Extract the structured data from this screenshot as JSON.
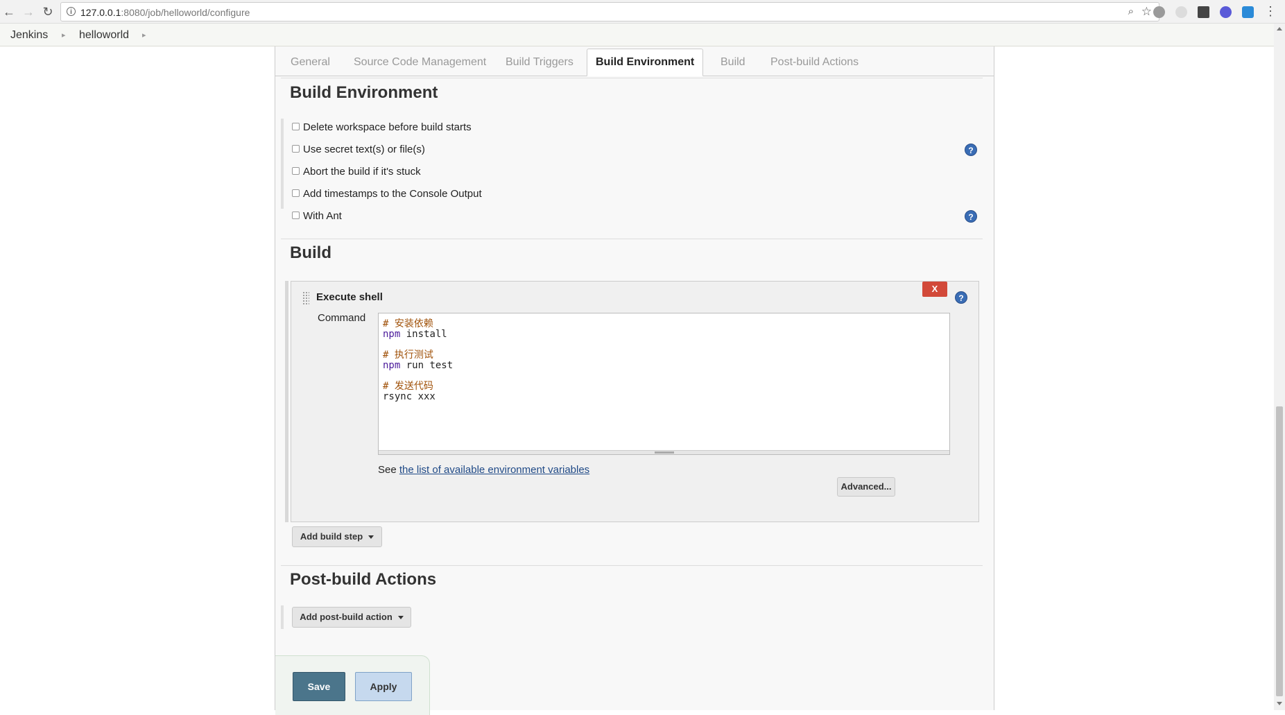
{
  "browser": {
    "url_host": "127.0.0.1",
    "url_rest": ":8080/job/helloworld/configure",
    "back_icon": "←",
    "forward_icon": "→",
    "reload_icon": "↻",
    "info_icon": "i",
    "zoom_icon": "⌕",
    "star_icon": "☆",
    "menu_icon": "⋮"
  },
  "breadcrumb": {
    "items": [
      "Jenkins",
      "helloworld"
    ],
    "arrow": "▸"
  },
  "tabs": [
    "General",
    "Source Code Management",
    "Build Triggers",
    "Build Environment",
    "Build",
    "Post-build Actions"
  ],
  "active_tab": "Build Environment",
  "build_environment": {
    "title": "Build Environment",
    "options": [
      "Delete workspace before build starts",
      "Use secret text(s) or file(s)",
      "Abort the build if it's stuck",
      "Add timestamps to the Console Output",
      "With Ant"
    ]
  },
  "build": {
    "title": "Build",
    "step_title": "Execute shell",
    "delete_label": "X",
    "command_label": "Command",
    "command_lines": [
      {
        "comment": "# 安装依赖"
      },
      {
        "kw": "npm",
        "rest": " install"
      },
      {
        "blank": ""
      },
      {
        "comment": "# 执行测试"
      },
      {
        "kw": "npm",
        "rest": " run test"
      },
      {
        "blank": ""
      },
      {
        "comment": "# 发送代码"
      },
      {
        "plain": "rsync xxx"
      }
    ],
    "see_prefix": "See ",
    "env_link": "the list of available environment variables",
    "advanced_label": "Advanced...",
    "add_step_label": "Add build step"
  },
  "post_build": {
    "title": "Post-build Actions",
    "add_action_label": "Add post-build action"
  },
  "help_icon": "?",
  "footer": {
    "save_label": "Save",
    "apply_label": "Apply"
  },
  "colors": {
    "save": "#4b758b",
    "apply": "#c6d9ee",
    "delete": "#d24939",
    "help": "#3a6db5"
  }
}
